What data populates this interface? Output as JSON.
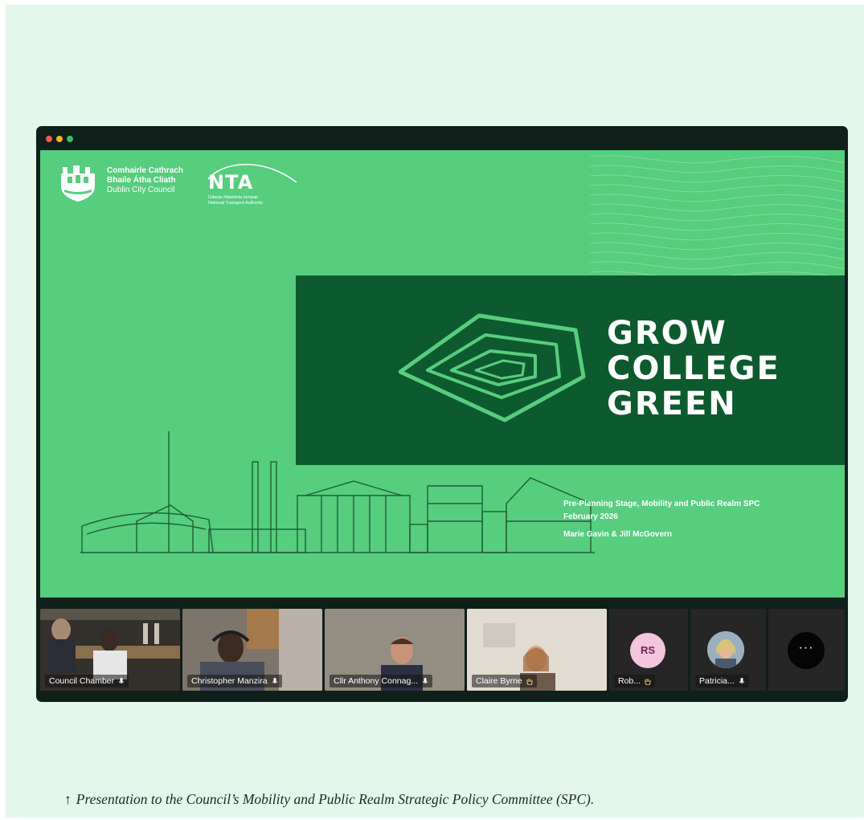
{
  "window": {
    "controls": [
      "close-dot",
      "minimize-dot",
      "zoom-dot"
    ]
  },
  "slide": {
    "dcc_name_line1": "Comhairle Cathrach",
    "dcc_name_line2": "Bhaile Átha Cliath",
    "dcc_name_line3": "Dublin City Council",
    "nta_word": "NTA",
    "nta_sub_line1": "Údarás Náisiúnta Iompair",
    "nta_sub_line2": "National Transport Authority",
    "title_line1": "GROW",
    "title_line2": "COLLEGE",
    "title_line3": "GREEN",
    "stage_line": "Pre-Planning Stage, Mobility and Public Realm SPC",
    "date_line": "February 2026",
    "presenters": "Marie Gavin & Jill McGovern",
    "colors": {
      "background": "#57cd7e",
      "dark_box": "#0d5a2e",
      "emblem": "#57cd7e",
      "text": "#ffffff"
    }
  },
  "participants": [
    {
      "name": "Council Chamber",
      "icon": "mic-icon"
    },
    {
      "name": "Christopher Manzira",
      "icon": "mic-icon"
    },
    {
      "name": "Cllr Anthony Connag...",
      "icon": "mic-icon"
    },
    {
      "name": "Claire Byrne",
      "icon": "raised-hand-icon"
    },
    {
      "name": "Rob...",
      "initials": "RS",
      "icon": "raised-hand-icon"
    },
    {
      "name": "Patricia...",
      "icon": "mic-icon"
    }
  ],
  "more_button": "···",
  "caption": {
    "arrow": "↑",
    "text": "Presentation to the Council’s Mobility and Public Realm Strategic Policy Committee (SPC)."
  }
}
